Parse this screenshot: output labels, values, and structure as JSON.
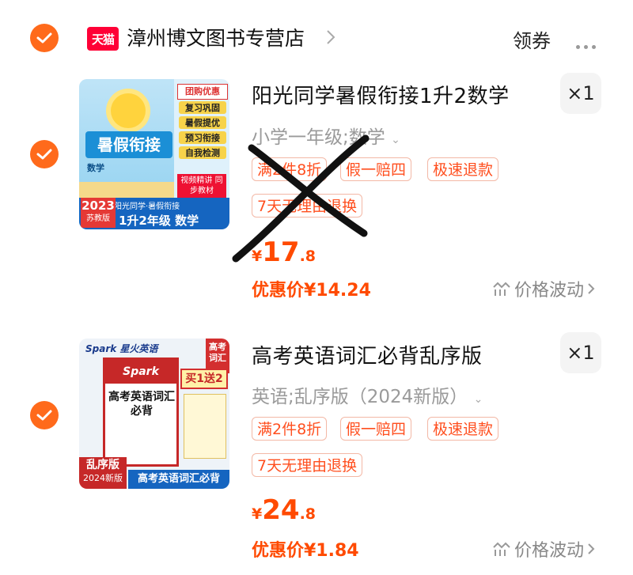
{
  "store": {
    "logo_text": "天猫",
    "name": "漳州博文图书专营店",
    "coupon_label": "领券",
    "more_icon": "more-dots-icon"
  },
  "accent_color": "#ff6a1b",
  "items": [
    {
      "title": "阳光同学暑假衔接1升2数学",
      "qty": "×1",
      "sku": "小学一年级;数学",
      "tags": [
        "满2件8折",
        "假一赔四",
        "极速退款",
        "7天无理由退换"
      ],
      "price_currency": "¥",
      "price_int": "17",
      "price_dec": ".8",
      "discount_label": "优惠价¥14.24",
      "trend_label": "价格波动",
      "thumb": {
        "top_banner": "团购优惠",
        "menu": [
          "复习巩固",
          "暑假提优",
          "预习衔接",
          "自我检测"
        ],
        "cover_title": "暑假衔接",
        "cover_sub": "数学",
        "badge": "视频精讲 同步教材",
        "series": "阳光同学·暑假衔接",
        "year": "2023",
        "edition": "苏教版",
        "grade": "1升2年级 数学"
      }
    },
    {
      "title": "高考英语词汇必背乱序版",
      "qty": "×1",
      "sku": "英语;乱序版（2024新版）",
      "tags": [
        "满2件8折",
        "假一赔四",
        "极速退款",
        "7天无理由退换"
      ],
      "price_currency": "¥",
      "price_int": "24",
      "price_dec": ".8",
      "discount_label": "优惠价¥1.84",
      "trend_label": "价格波动",
      "thumb": {
        "brand": "Spark 星火英语",
        "corner": "高考词汇",
        "promo": "买1送2",
        "book_title": "高考英语词汇必背",
        "edition": "乱序版",
        "year": "2024新版",
        "footer": "高考英语词汇必背"
      }
    }
  ]
}
